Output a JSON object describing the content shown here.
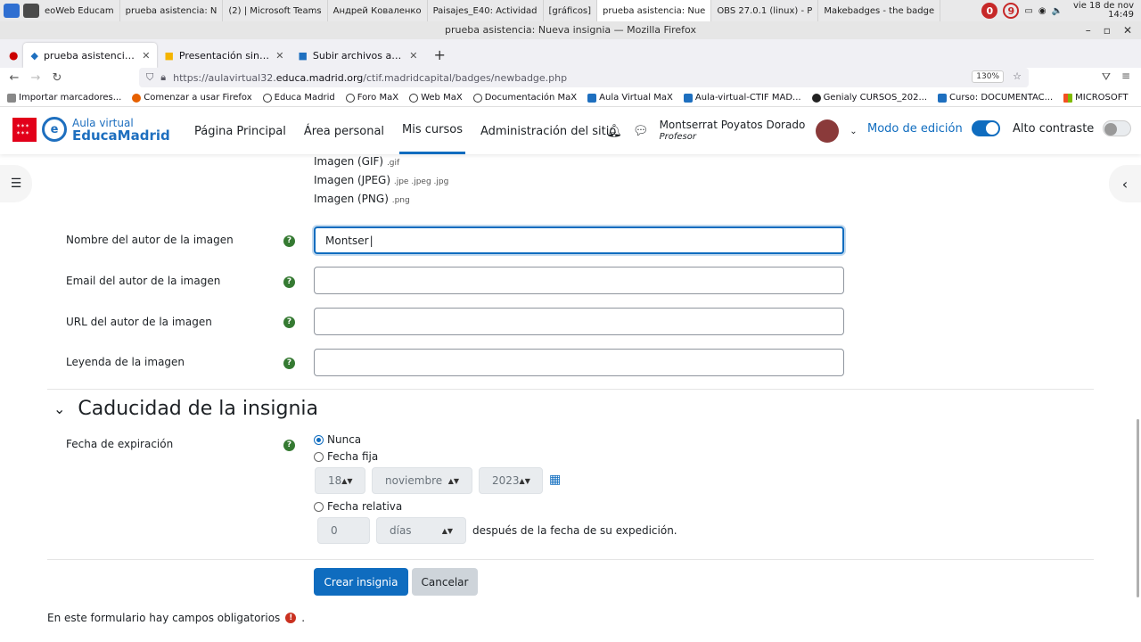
{
  "taskbar": {
    "items": [
      "eoWeb Educam",
      "prueba asistencia: N",
      "(2) | Microsoft Teams",
      "Андрей Коваленко",
      "Paisajes_E40: Actividad",
      "[gráficos]",
      "prueba asistencia: Nue",
      "OBS 27.0.1 (linux) - P",
      "Makebadges - the badge"
    ],
    "badge1": "0",
    "badge2": "9",
    "clock_line1": "vie 18 de nov",
    "clock_line2": "14:49"
  },
  "window_title": "prueba asistencia: Nueva insignia — Mozilla Firefox",
  "browser_tabs": [
    {
      "label": "prueba asistencia: Nueva",
      "active": true
    },
    {
      "label": "Presentación sin título - F",
      "active": false
    },
    {
      "label": "Subir archivos a la Media",
      "active": false
    }
  ],
  "url": {
    "prefix": "https://aulavirtual32.",
    "domain": "educa.madrid.org",
    "path": "/ctif.madridcapital/badges/newbadge.php",
    "zoom": "130%"
  },
  "bookmarks": [
    "Importar marcadores...",
    "Comenzar a usar Firefox",
    "Educa Madrid",
    "Foro MaX",
    "Web MaX",
    "Documentación MaX",
    "Aula Virtual MaX",
    "Aula-virtual-CTIF MAD...",
    "Genialy CURSOS_202...",
    "Curso: DOCUMENTAC...",
    "MICROSOFT"
  ],
  "site": {
    "logo_line1": "Aula virtual",
    "logo_line2": "EducaMadrid",
    "nav": [
      {
        "label": "Página Principal",
        "active": false
      },
      {
        "label": "Área personal",
        "active": false
      },
      {
        "label": "Mis cursos",
        "active": true
      },
      {
        "label": "Administración del sitio",
        "active": false
      }
    ],
    "user_name": "Montserrat Poyatos Dorado",
    "user_role": "Profesor",
    "edit_mode_label": "Modo de edición",
    "edit_mode_on": true,
    "high_contrast_label": "Alto contraste",
    "high_contrast_on": false
  },
  "file_types": [
    {
      "name": "Imagen (GIF)",
      "ext": ".gif"
    },
    {
      "name": "Imagen (JPEG)",
      "ext": ".jpe .jpeg .jpg"
    },
    {
      "name": "Imagen (PNG)",
      "ext": ".png"
    }
  ],
  "fields": {
    "author_name_label": "Nombre del autor de la imagen",
    "author_name_value": "Montser",
    "author_email_label": "Email del autor de la imagen",
    "author_email_value": "",
    "author_url_label": "URL del autor de la imagen",
    "author_url_value": "",
    "caption_label": "Leyenda de la imagen",
    "caption_value": ""
  },
  "expiry": {
    "section_title": "Caducidad de la insignia",
    "label": "Fecha de expiración",
    "opt_never": "Nunca",
    "opt_fixed": "Fecha fija",
    "opt_relative": "Fecha relativa",
    "selected": "never",
    "day": "18",
    "month": "noviembre",
    "year": "2023",
    "relative_number": "0",
    "relative_unit": "días",
    "after_text": "después de la fecha de su expedición."
  },
  "buttons": {
    "create": "Crear insignia",
    "cancel": "Cancelar"
  },
  "footnote": "En este formulario hay campos obligatorios",
  "colors": {
    "primary": "#0f6cbf",
    "help": "#357a32",
    "required": "#ca3120"
  }
}
